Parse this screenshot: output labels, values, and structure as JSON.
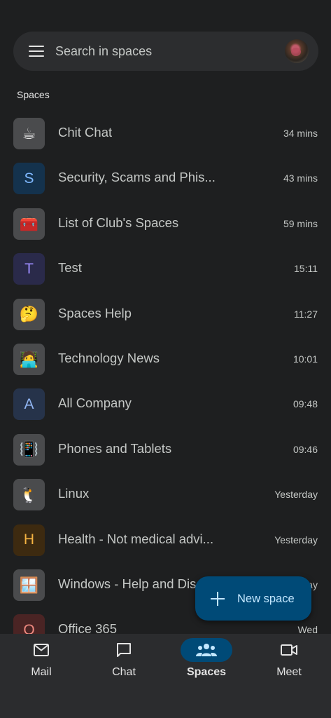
{
  "search": {
    "placeholder": "Search in spaces"
  },
  "section": {
    "label": "Spaces"
  },
  "spaces": [
    {
      "icon": "☕",
      "icon_name": "coffee-icon",
      "name": "Chit Chat",
      "time": "34 mins",
      "bg": "#4a4b4d"
    },
    {
      "letter": "S",
      "name": "Security, Scams and Phis...",
      "time": "43 mins",
      "bg": "#14324d",
      "fg": "#7fb8ff"
    },
    {
      "icon": "🧰",
      "icon_name": "toolbox-icon",
      "name": "List of Club's Spaces",
      "time": "59 mins",
      "bg": "#4a4b4d"
    },
    {
      "letter": "T",
      "name": "Test",
      "time": "15:11",
      "bg": "#2a2a4a",
      "fg": "#9d8cff"
    },
    {
      "icon": "🤔",
      "icon_name": "thinking-face-icon",
      "name": "Spaces Help",
      "time": "11:27",
      "bg": "#4a4b4d"
    },
    {
      "icon": "🧑‍💻",
      "icon_name": "technologist-icon",
      "name": "Technology News",
      "time": "10:01",
      "bg": "#4a4b4d"
    },
    {
      "letter": "A",
      "name": "All Company",
      "time": "09:48",
      "bg": "#26334a",
      "fg": "#90b4f0"
    },
    {
      "icon": "📳",
      "icon_name": "vibrating-phone-icon",
      "name": "Phones and Tablets",
      "time": "09:46",
      "bg": "#4a4b4d"
    },
    {
      "icon": "🐧",
      "icon_name": "penguin-icon",
      "name": "Linux",
      "time": "Yesterday",
      "bg": "#4a4b4d"
    },
    {
      "letter": "H",
      "name": "Health - Not medical advi...",
      "time": "Yesterday",
      "bg": "#3d2a10",
      "fg": "#f5b342"
    },
    {
      "icon": "🪟",
      "icon_name": "window-icon",
      "name": "Windows - Help and Dis",
      "time": "Yesterday",
      "bg": "#4a4b4d"
    },
    {
      "letter": "O",
      "name": "Office 365",
      "time": "Wed",
      "bg": "#4a2424",
      "fg": "#f08a80"
    }
  ],
  "fab": {
    "label": "New space"
  },
  "nav": [
    {
      "label": "Mail",
      "icon": "mail-icon",
      "active": false
    },
    {
      "label": "Chat",
      "icon": "chat-icon",
      "active": false
    },
    {
      "label": "Spaces",
      "icon": "spaces-icon",
      "active": true
    },
    {
      "label": "Meet",
      "icon": "video-icon",
      "active": false
    }
  ],
  "colors": {
    "background": "#1e1f20",
    "search_bg": "#2c2d2f",
    "fab_bg": "#004a77",
    "fab_fg": "#c2e7ff",
    "nav_bg": "#2b2c2e"
  }
}
